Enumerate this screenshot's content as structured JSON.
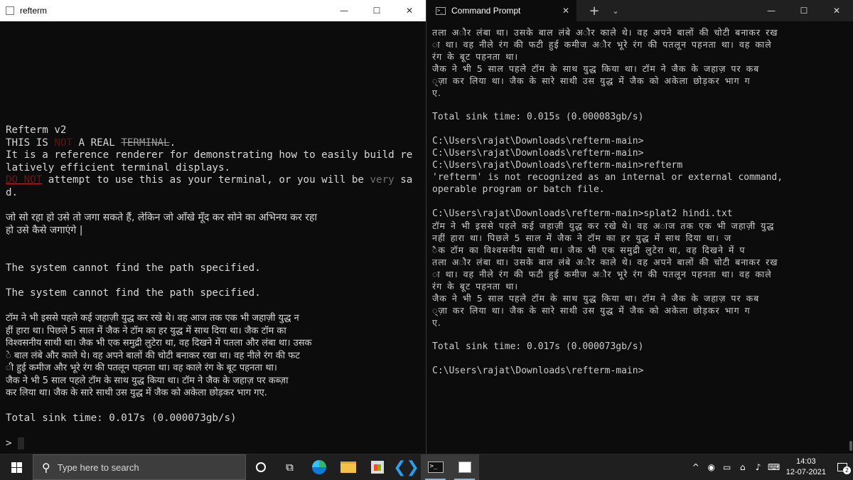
{
  "refterm": {
    "title": "refterm",
    "minimize": "—",
    "maximize": "☐",
    "close": "✕",
    "line_version": "Refterm v2",
    "line_this_is": "THIS IS ",
    "line_not": "NOT",
    "line_a_real": " A REAL ",
    "line_terminal": "TERMINAL",
    "line_dot": ".",
    "line_ref1": "It is a reference renderer for demonstrating how to easily build re",
    "line_ref2": "latively efficient terminal displays.",
    "line_donot": "DO NOT",
    "line_attempt": " attempt to use this as your terminal, or you will be ",
    "line_very": "very",
    "line_sa": " sa",
    "line_d": "d.",
    "hindi_q1": "जो सो रहा हो उसे तो जगा सकते हैं, लेकिन जो आँखे मूँद कर सोने का अभिनय कर रहा",
    "hindi_q2": "हो उसे कैसे जगाएंगे |",
    "err1": "The system cannot find the path specified.",
    "err2": "The system cannot find the path specified.",
    "story": [
      "टॉम ने भी इससे पहले कई जहाज़ी युद्ध कर रखे थे। वह आज तक एक भी जहाज़ी युद्ध न",
      "हीं हारा था। पिछले 5 साल में जैक ने टॉम का हर युद्ध में साथ दिया था। जैक टॉम का",
      "विश्वसनीय साथी था। जैक भी एक समुद्री लुटेरा था, वह दिखने में पतला और लंबा था। उसक",
      "े बाल लंबे और काले थे। वह अपने बालों की चोटी बनाकर रखा था। वह नीले रंग की फट",
      "ी हुई कमीज और भूरे रंग की पतलून पहनता था। वह काले रंग के बूट पहनता था।",
      "जैक ने भी 5 साल पहले टॉम के साथ युद्ध किया था। टॉम ने जैक के जहाज़ पर कब्ज़ा",
      " कर लिया था। जैक के सारे साथी उस युद्ध में जैक को अकेला छोड़कर भाग गए."
    ],
    "sink": "Total sink time: 0.017s (0.000073gb/s)",
    "prompt": ">"
  },
  "cmd": {
    "tab_title": "Command Prompt",
    "tab_close": "✕",
    "new_tab": "+",
    "dropdown": "⌄",
    "minimize": "—",
    "maximize": "☐",
    "close": "✕",
    "lines_top": [
      "तला अौर लंबा था। उसके बाल लंबे अौर काले थे। वह अपने बालों की चोटी बनाकर रख",
      "ा था। वह नीले रंग की फटी हुई कमीज अौर भूरे रंग की पतलून पहनता था। वह काले",
      " रंग के बूट पहनता था।",
      "जैक ने भी 5 साल पहले टॉम के साथ युद्ध किया था। टॉम ने जैक के जहाज़ पर कब",
      "्ज़ा कर लिया था। जैक के सारे साथी उस युद्ध में जैक को अकेला छोड़कर भाग ग",
      "ए."
    ],
    "sink1": "Total sink time: 0.015s (0.000083gb/s)",
    "prompt1": "C:\\Users\\rajat\\Downloads\\refterm-main>",
    "prompt2": "C:\\Users\\rajat\\Downloads\\refterm-main>",
    "prompt3": "C:\\Users\\rajat\\Downloads\\refterm-main>refterm",
    "not_recognized1": "'refterm' is not recognized as an internal or external command,",
    "not_recognized2": "operable program or batch file.",
    "prompt4": "C:\\Users\\rajat\\Downloads\\refterm-main>splat2 hindi.txt",
    "lines_bottom": [
      "टॉम ने भी इससे पहले कई जहाज़ी युद्ध कर रखे थे। वह अाज तक एक भी जहाज़ी युद्ध",
      " नहीं हारा था। पिछले 5 साल में जैक ने टॉम का हर युद्ध में साथ दिया था। ज",
      "ैक टॉम का विश्वसनीय साथी था। जैक भी एक समुद्री लुटेरा था, वह दिखने में प",
      "तला अौर लंबा था। उसके बाल लंबे अौर काले थे। वह अपने बालों की चोटी बनाकर रख",
      "ा था। वह नीले रंग की फटी हुई कमीज अौर भूरे रंग की पतलून पहनता था। वह काले",
      " रंग के बूट पहनता था।",
      "जैक ने भी 5 साल पहले टॉम के साथ युद्ध किया था। टॉम ने जैक के जहाज़ पर कब",
      "्ज़ा कर लिया था। जैक के सारे साथी उस युद्ध में जैक को अकेला छोड़कर भाग ग",
      "ए."
    ],
    "sink2": "Total sink time: 0.017s (0.000073gb/s)",
    "prompt5": "C:\\Users\\rajat\\Downloads\\refterm-main>"
  },
  "taskbar": {
    "search_placeholder": "Type here to search",
    "search_icon": "⚲",
    "taskview_icon": "⧉",
    "vscode_icon": "❮❯",
    "terminal_glyph": ">_",
    "tray_chevron": "^",
    "tray_network": "⌂",
    "tray_speaker": "♪",
    "tray_lang": "ENG",
    "time": "14:03",
    "date": "12-07-2021",
    "notif_count": "2"
  },
  "colors": {
    "left_bg": "#0c0c0c",
    "right_titlebar": "#202020",
    "taskbar": "#1f1f1f",
    "accent": "#76b9ed"
  }
}
